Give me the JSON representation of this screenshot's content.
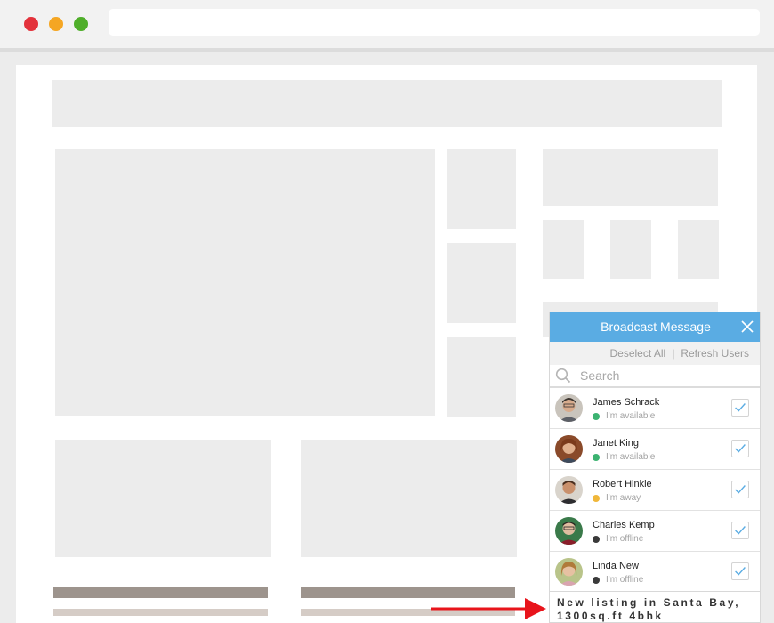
{
  "panel": {
    "title": "Broadcast Message",
    "deselect_all": "Deselect All",
    "separator": "|",
    "refresh_users": "Refresh Users",
    "search_placeholder": "Search",
    "users": [
      {
        "name": "James Schrack",
        "status": "I'm available",
        "status_color": "#3cb371",
        "checked": true
      },
      {
        "name": "Janet King",
        "status": "I'm available",
        "status_color": "#3cb371",
        "checked": true
      },
      {
        "name": "Robert Hinkle",
        "status": "I'm away",
        "status_color": "#f0b73a",
        "checked": true
      },
      {
        "name": "Charles Kemp",
        "status": "I'm offline",
        "status_color": "#3a3a3a",
        "checked": true
      },
      {
        "name": "Linda New",
        "status": "I'm offline",
        "status_color": "#3a3a3a",
        "checked": true
      }
    ],
    "message": "New listing in Santa Bay, 1300sq.ft 4bhk"
  },
  "colors": {
    "accent": "#5aace3",
    "annotation_arrow": "#e8141b"
  }
}
